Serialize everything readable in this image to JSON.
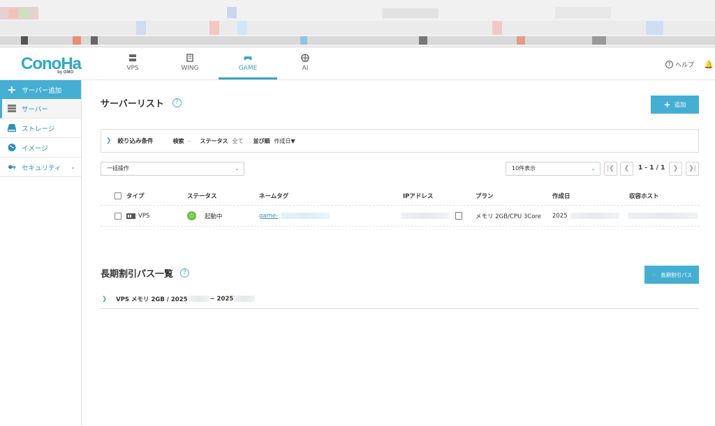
{
  "header": {
    "logo": "ConoHa",
    "logo_sub": "by GMO",
    "tabs": [
      {
        "label": "VPS",
        "icon": "server-icon"
      },
      {
        "label": "WING",
        "icon": "building-icon"
      },
      {
        "label": "GAME",
        "icon": "gamepad-icon",
        "active": true
      },
      {
        "label": "AI",
        "icon": "ai-icon"
      }
    ],
    "help_label": "ヘルプ"
  },
  "sidebar": {
    "add_label": "サーバー追加",
    "items": [
      {
        "label": "サーバー",
        "icon": "server-icon",
        "active": true
      },
      {
        "label": "ストレージ",
        "icon": "storage-icon"
      },
      {
        "label": "イメージ",
        "icon": "image-icon"
      },
      {
        "label": "セキュリティ",
        "icon": "key-icon",
        "has_chevron": true
      }
    ]
  },
  "server_list": {
    "title": "サーバーリスト",
    "add_button": "追加",
    "filter": {
      "label": "絞り込み条件",
      "search_key": "検索",
      "search_value": "-",
      "status_key": "ステータス",
      "status_value": "全て",
      "sort_key": "並び順",
      "sort_value": "作成日▼"
    },
    "bulk_action": "一括操作",
    "per_page": "10件表示",
    "pagination": "1 - 1 / 1",
    "columns": [
      "タイプ",
      "ステータス",
      "ネームタグ",
      "IPアドレス",
      "プラン",
      "作成日",
      "収容ホスト"
    ],
    "rows": [
      {
        "type": "VPS",
        "status": "起動中",
        "name_tag": "game-",
        "plan": "メモリ 2GB/CPU 3Core",
        "created": "2025"
      }
    ]
  },
  "pass_list": {
    "title": "長期割引パス一覧",
    "button": "長期割引パス",
    "items": [
      {
        "label_prefix": "VPS メモリ 2GB / 2025",
        "label_mid": " ~ 2025"
      }
    ]
  },
  "colors": {
    "accent": "#45aed3",
    "status_running": "#6bbf3a"
  }
}
